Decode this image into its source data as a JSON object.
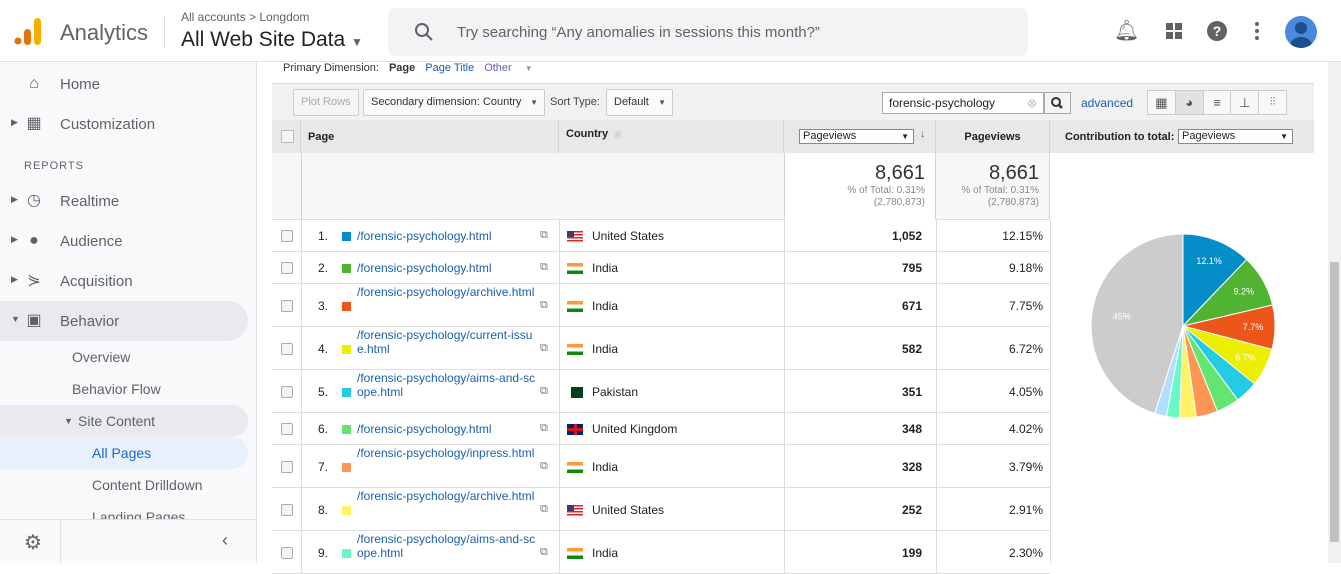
{
  "header": {
    "app_name": "Analytics",
    "breadcrumb": "All accounts > Longdom",
    "property": "All Web Site Data",
    "search_placeholder": "Try searching “Any anomalies in sessions this month?”"
  },
  "sidebar": {
    "items": [
      {
        "label": "Home",
        "icon": "home-icon"
      },
      {
        "label": "Customization",
        "icon": "dashboard-icon"
      },
      {
        "label": "Realtime",
        "icon": "clock-icon"
      },
      {
        "label": "Audience",
        "icon": "person-icon"
      },
      {
        "label": "Acquisition",
        "icon": "acquisition-icon"
      },
      {
        "label": "Behavior",
        "icon": "behavior-icon"
      }
    ],
    "section": "REPORTS",
    "sub": [
      "Overview",
      "Behavior Flow",
      "Site Content",
      "All Pages",
      "Content Drilldown",
      "Landing Pages"
    ]
  },
  "toolbar": {
    "primary_label": "Primary Dimension:",
    "primary_active": "Page",
    "primary_page_title": "Page Title",
    "primary_other": "Other",
    "plot_rows": "Plot Rows",
    "secondary": "Secondary dimension: Country",
    "sort_label": "Sort Type:",
    "sort_value": "Default",
    "filter_value": "forensic-psychology",
    "advanced": "advanced"
  },
  "table": {
    "headers": {
      "page": "Page",
      "country": "Country",
      "metric_select": "Pageviews",
      "pageviews": "Pageviews",
      "contribution_label": "Contribution to total:",
      "contribution_select": "Pageviews"
    },
    "totals": {
      "value": "8,661",
      "pct": "% of Total: 0.31%",
      "total": "(2,780,873)"
    },
    "rows": [
      {
        "n": "1.",
        "page": "/forensic-psychology.html",
        "country": "United States",
        "pv": "1,052",
        "pct": "12.15%",
        "color": "#058dc7",
        "flag": "us"
      },
      {
        "n": "2.",
        "page": "/forensic-psychology.html",
        "country": "India",
        "pv": "795",
        "pct": "9.18%",
        "color": "#50b432",
        "flag": "in"
      },
      {
        "n": "3.",
        "page": "/forensic-psychology/archive.html",
        "country": "India",
        "pv": "671",
        "pct": "7.75%",
        "color": "#ed561b",
        "flag": "in"
      },
      {
        "n": "4.",
        "page": "/forensic-psychology/current-issue.html",
        "country": "India",
        "pv": "582",
        "pct": "6.72%",
        "color": "#edef00",
        "flag": "in"
      },
      {
        "n": "5.",
        "page": "/forensic-psychology/aims-and-scope.html",
        "country": "Pakistan",
        "pv": "351",
        "pct": "4.05%",
        "color": "#24cbe5",
        "flag": "pk"
      },
      {
        "n": "6.",
        "page": "/forensic-psychology.html",
        "country": "United Kingdom",
        "pv": "348",
        "pct": "4.02%",
        "color": "#64e572",
        "flag": "gb"
      },
      {
        "n": "7.",
        "page": "/forensic-psychology/inpress.html",
        "country": "India",
        "pv": "328",
        "pct": "3.79%",
        "color": "#ff9655",
        "flag": "in"
      },
      {
        "n": "8.",
        "page": "/forensic-psychology/archive.html",
        "country": "United States",
        "pv": "252",
        "pct": "2.91%",
        "color": "#fff263",
        "flag": "us"
      },
      {
        "n": "9.",
        "page": "/forensic-psychology/aims-and-scope.html",
        "country": "India",
        "pv": "199",
        "pct": "2.30%",
        "color": "#6af9c4",
        "flag": "in"
      }
    ]
  },
  "chart_data": {
    "type": "pie",
    "values": [
      12.15,
      9.18,
      7.75,
      6.72,
      4.05,
      4.02,
      3.79,
      2.91,
      2.3,
      2.1,
      45
    ],
    "colors": [
      "#058dc7",
      "#50b432",
      "#ed561b",
      "#edef00",
      "#24cbe5",
      "#64e572",
      "#ff9655",
      "#fff263",
      "#6af9c4",
      "#b2deff",
      "#cccccc"
    ],
    "labels": [
      "12.1%",
      "9.2%",
      "7.7%",
      "6.7%",
      "",
      "",
      "",
      "",
      "",
      "",
      "45%"
    ]
  }
}
